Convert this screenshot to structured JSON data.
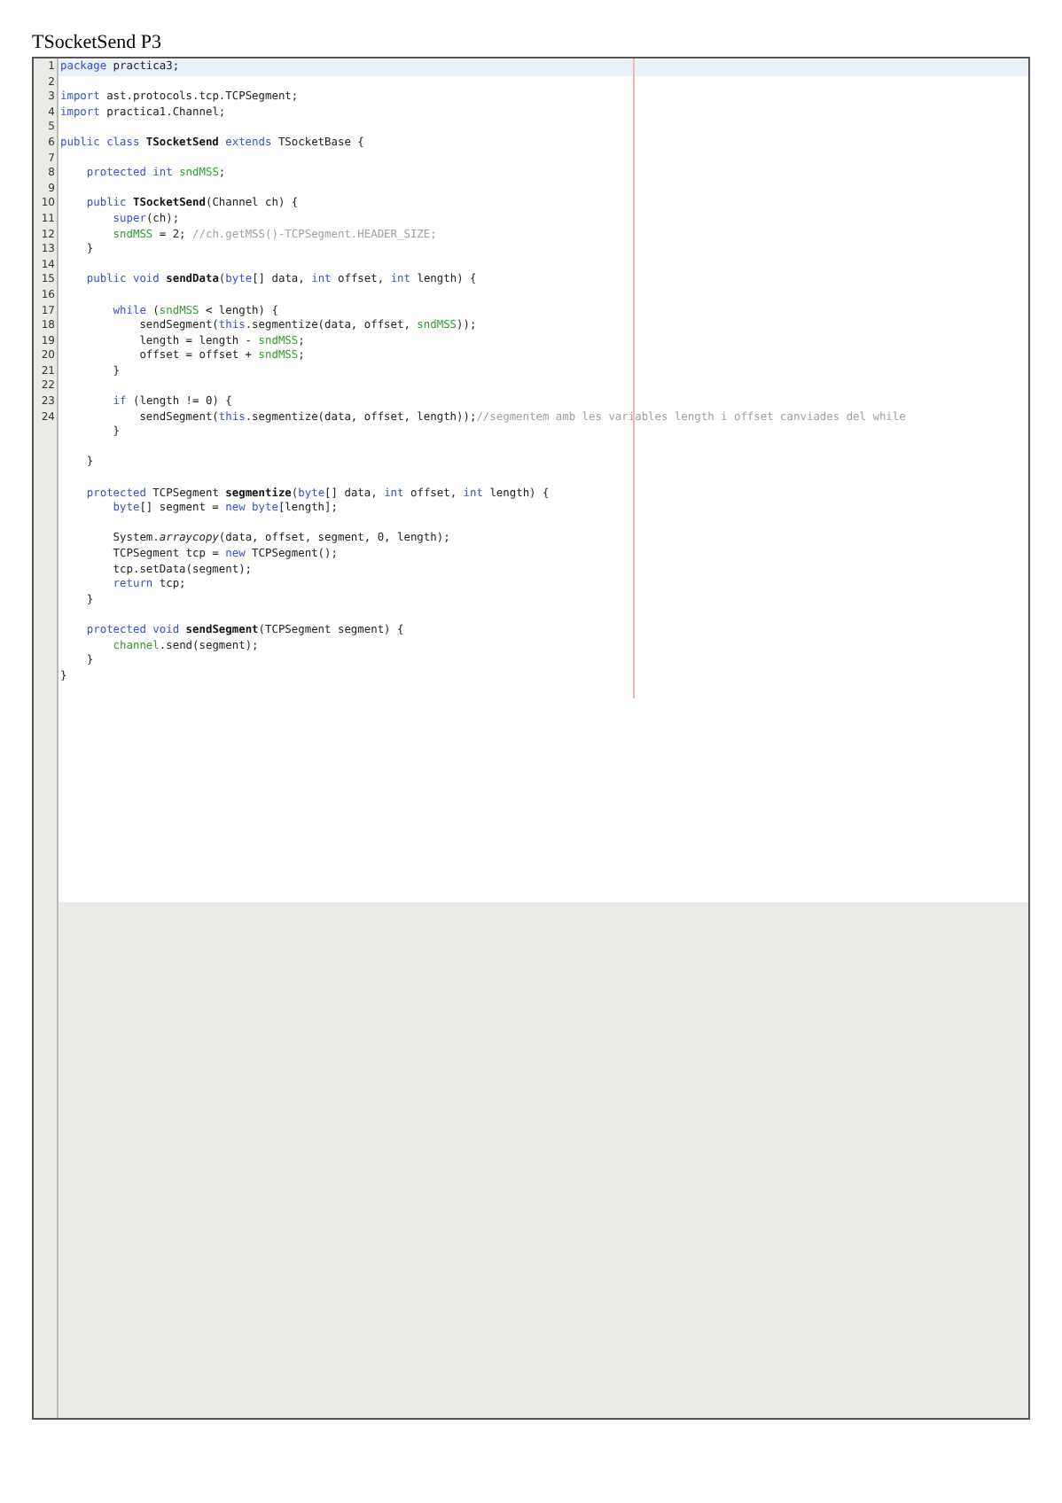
{
  "title": "TSocketSend P3",
  "lines": [
    {
      "number": "1",
      "current": true,
      "tokens": [
        {
          "kind": "keyword",
          "text": "package"
        },
        {
          "kind": "plain",
          "text": " practica3;"
        }
      ]
    },
    {
      "number": "2",
      "current": false
    },
    {
      "number": "3",
      "current": false,
      "tokens": [
        {
          "kind": "keyword",
          "text": "import"
        },
        {
          "kind": "plain",
          "text": " ast.protocols.tcp.TCPSegment;"
        }
      ]
    },
    {
      "number": "4",
      "current": false,
      "tokens": [
        {
          "kind": "keyword",
          "text": "import"
        },
        {
          "kind": "plain",
          "text": " practica1.Channel;"
        }
      ]
    },
    {
      "number": "5",
      "current": false
    },
    {
      "number": "6",
      "current": false,
      "tokens": [
        {
          "kind": "keyword",
          "text": "public class"
        },
        {
          "kind": "declaration",
          "text": " TSocketSend"
        },
        {
          "kind": "keyword",
          "text": " extends"
        },
        {
          "kind": "plain",
          "text": " TSocketBase {"
        }
      ]
    },
    {
      "number": "7",
      "current": false
    },
    {
      "number": "8",
      "current": false,
      "tokens": [
        {
          "kind": "keyword",
          "text": "    protected int"
        },
        {
          "kind": "field",
          "text": " sndMSS"
        },
        {
          "kind": "plain",
          "text": ";"
        }
      ]
    },
    {
      "number": "9",
      "current": false
    },
    {
      "number": "10",
      "current": false,
      "tokens": [
        {
          "kind": "keyword",
          "text": "    public"
        },
        {
          "kind": "declaration",
          "text": " TSocketSend"
        },
        {
          "kind": "plain",
          "text": "(Channel ch) {"
        }
      ]
    },
    {
      "number": "11",
      "current": false,
      "tokens": [
        {
          "kind": "keyword",
          "text": "        super"
        },
        {
          "kind": "plain",
          "text": "(ch);"
        }
      ]
    },
    {
      "number": "12",
      "current": false,
      "tokens": [
        {
          "kind": "field",
          "text": "        sndMSS"
        },
        {
          "kind": "plain",
          "text": " = 2; "
        },
        {
          "kind": "comment",
          "text": "//ch.getMSS()-TCPSegment.HEADER_SIZE;"
        }
      ]
    },
    {
      "number": "13",
      "current": false,
      "tokens": [
        {
          "kind": "plain",
          "text": "    }"
        }
      ]
    },
    {
      "number": "14",
      "current": false
    },
    {
      "number": "15",
      "current": false,
      "tokens": [
        {
          "kind": "keyword",
          "text": "    public void"
        },
        {
          "kind": "declaration",
          "text": " sendData"
        },
        {
          "kind": "plain",
          "text": "("
        },
        {
          "kind": "keyword",
          "text": "byte"
        },
        {
          "kind": "plain",
          "text": "[] data, "
        },
        {
          "kind": "keyword",
          "text": "int"
        },
        {
          "kind": "plain",
          "text": " offset, "
        },
        {
          "kind": "keyword",
          "text": "int"
        },
        {
          "kind": "plain",
          "text": " length) {"
        }
      ]
    },
    {
      "number": "16",
      "current": false
    },
    {
      "number": "17",
      "current": false,
      "tokens": [
        {
          "kind": "keyword",
          "text": "        while"
        },
        {
          "kind": "plain",
          "text": " ("
        },
        {
          "kind": "field",
          "text": "sndMSS"
        },
        {
          "kind": "plain",
          "text": " < length) {"
        }
      ]
    },
    {
      "number": "18",
      "current": false,
      "tokens": [
        {
          "kind": "plain",
          "text": "            sendSegment("
        },
        {
          "kind": "keyword",
          "text": "this"
        },
        {
          "kind": "plain",
          "text": ".segmentize(data, offset, "
        },
        {
          "kind": "field",
          "text": "sndMSS"
        },
        {
          "kind": "plain",
          "text": "));"
        }
      ]
    },
    {
      "number": "19",
      "current": false,
      "tokens": [
        {
          "kind": "plain",
          "text": "            length = length - "
        },
        {
          "kind": "field",
          "text": "sndMSS"
        },
        {
          "kind": "plain",
          "text": ";"
        }
      ]
    },
    {
      "number": "20",
      "current": false,
      "tokens": [
        {
          "kind": "plain",
          "text": "            offset = offset + "
        },
        {
          "kind": "field",
          "text": "sndMSS"
        },
        {
          "kind": "plain",
          "text": ";"
        }
      ]
    },
    {
      "number": "21",
      "current": false,
      "tokens": [
        {
          "kind": "plain",
          "text": "        }"
        }
      ]
    },
    {
      "number": "22",
      "current": false
    },
    {
      "number": "23",
      "current": false,
      "tokens": [
        {
          "kind": "keyword",
          "text": "        if"
        },
        {
          "kind": "plain",
          "text": " (length != 0) {"
        }
      ]
    },
    {
      "number": "24",
      "current": false,
      "tokens": [
        {
          "kind": "plain",
          "text": "            sendSegment("
        },
        {
          "kind": "keyword",
          "text": "this"
        },
        {
          "kind": "plain",
          "text": ".segmentize(data, offset, length));"
        },
        {
          "kind": "comment",
          "text": "//segmentem amb les variables length i offset canviades del while"
        }
      ]
    },
    {
      "current": false,
      "tokens": [
        {
          "kind": "plain",
          "text": "        }"
        }
      ]
    },
    {
      "current": false
    },
    {
      "current": false,
      "tokens": [
        {
          "kind": "plain",
          "text": "    }"
        }
      ]
    },
    {
      "current": false
    },
    {
      "current": false,
      "tokens": [
        {
          "kind": "keyword",
          "text": "    protected"
        },
        {
          "kind": "plain",
          "text": " TCPSegment "
        },
        {
          "kind": "declaration",
          "text": "segmentize"
        },
        {
          "kind": "plain",
          "text": "("
        },
        {
          "kind": "keyword",
          "text": "byte"
        },
        {
          "kind": "plain",
          "text": "[] data, "
        },
        {
          "kind": "keyword",
          "text": "int"
        },
        {
          "kind": "plain",
          "text": " offset, "
        },
        {
          "kind": "keyword",
          "text": "int"
        },
        {
          "kind": "plain",
          "text": " length) {"
        }
      ]
    },
    {
      "current": false,
      "tokens": [
        {
          "kind": "keyword",
          "text": "        byte"
        },
        {
          "kind": "plain",
          "text": "[] segment = "
        },
        {
          "kind": "keyword",
          "text": "new byte"
        },
        {
          "kind": "plain",
          "text": "[length];"
        }
      ]
    },
    {
      "current": false
    },
    {
      "current": false,
      "tokens": [
        {
          "kind": "plain",
          "text": "        System."
        },
        {
          "kind": "static",
          "text": "arraycopy"
        },
        {
          "kind": "plain",
          "text": "(data, offset, segment, 0, length);"
        }
      ]
    },
    {
      "current": false,
      "tokens": [
        {
          "kind": "plain",
          "text": "        TCPSegment tcp = "
        },
        {
          "kind": "keyword",
          "text": "new"
        },
        {
          "kind": "plain",
          "text": " TCPSegment();"
        }
      ]
    },
    {
      "current": false,
      "tokens": [
        {
          "kind": "plain",
          "text": "        tcp.setData(segment);"
        }
      ]
    },
    {
      "current": false,
      "tokens": [
        {
          "kind": "keyword",
          "text": "        return"
        },
        {
          "kind": "plain",
          "text": " tcp;"
        }
      ]
    },
    {
      "current": false,
      "tokens": [
        {
          "kind": "plain",
          "text": "    }"
        }
      ]
    },
    {
      "current": false
    },
    {
      "current": false,
      "tokens": [
        {
          "kind": "keyword",
          "text": "    protected void"
        },
        {
          "kind": "declaration",
          "text": " sendSegment"
        },
        {
          "kind": "plain",
          "text": "(TCPSegment segment) {"
        }
      ]
    },
    {
      "current": false,
      "tokens": [
        {
          "kind": "field",
          "text": "        channel"
        },
        {
          "kind": "plain",
          "text": ".send(segment);"
        }
      ]
    },
    {
      "current": false,
      "tokens": [
        {
          "kind": "plain",
          "text": "    }"
        }
      ]
    },
    {
      "current": false,
      "tokens": [
        {
          "kind": "plain",
          "text": "}"
        }
      ]
    }
  ]
}
